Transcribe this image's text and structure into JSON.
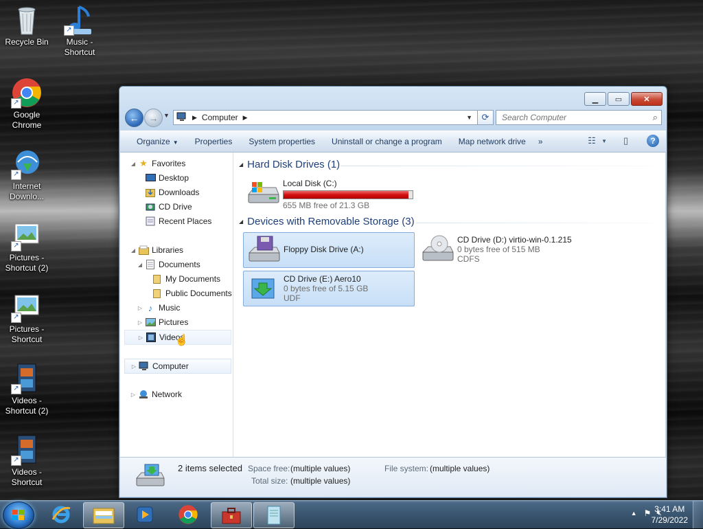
{
  "desktop": {
    "icons": [
      {
        "label": "Recycle Bin",
        "icon": "recycle-bin-icon"
      },
      {
        "label": "Music - Shortcut",
        "icon": "music-shortcut-icon"
      },
      {
        "label": "Google Chrome",
        "icon": "chrome-icon"
      },
      {
        "label": "Internet Downlo...",
        "icon": "internet-download-manager-icon"
      },
      {
        "label": "Pictures - Shortcut (2)",
        "icon": "pictures-shortcut-icon"
      },
      {
        "label": "Pictures - Shortcut",
        "icon": "pictures-shortcut-icon"
      },
      {
        "label": "Videos - Shortcut (2)",
        "icon": "videos-shortcut-icon"
      },
      {
        "label": "Videos - Shortcut",
        "icon": "videos-shortcut-icon"
      }
    ]
  },
  "window": {
    "address": {
      "root_icon": "computer-icon",
      "crumb": "Computer"
    },
    "search": {
      "placeholder": "Search Computer"
    },
    "toolbar": {
      "organize": "Organize",
      "properties": "Properties",
      "system_properties": "System properties",
      "uninstall": "Uninstall or change a program",
      "map_network_drive": "Map network drive",
      "more": "»"
    },
    "nav": {
      "favorites": "Favorites",
      "desktop": "Desktop",
      "downloads": "Downloads",
      "cd_drive": "CD Drive",
      "recent_places": "Recent Places",
      "libraries": "Libraries",
      "documents": "Documents",
      "my_documents": "My Documents",
      "public_documents": "Public Documents",
      "music": "Music",
      "pictures": "Pictures",
      "videos": "Videos",
      "computer": "Computer",
      "network": "Network"
    },
    "groups": {
      "hard_disk": "Hard Disk Drives (1)",
      "removable": "Devices with Removable Storage (3)"
    },
    "drives": {
      "c": {
        "name": "Local Disk (C:)",
        "free": "655 MB free of 21.3 GB",
        "used_fraction": 0.97
      },
      "a": {
        "name": "Floppy Disk Drive (A:)"
      },
      "d": {
        "name": "CD Drive (D:) virtio-win-0.1.215",
        "free": "0 bytes free of 515 MB",
        "fs": "CDFS"
      },
      "e": {
        "name": "CD Drive (E:) Aero10",
        "free": "0 bytes free of 5.15 GB",
        "fs": "UDF"
      }
    },
    "details": {
      "selection": "2 items selected",
      "space_free_label": "Space free:",
      "space_free_value": "(multiple values)",
      "total_size_label": "Total size:",
      "total_size_value": "(multiple values)",
      "file_system_label": "File system:",
      "file_system_value": "(multiple values)"
    }
  },
  "taskbar": {
    "items": [
      "windows-explorer",
      "media-player",
      "google-chrome",
      "toolbox",
      "notepad"
    ],
    "clock": {
      "time": "3:41 AM",
      "date": "7/29/2022"
    }
  },
  "colors": {
    "accent": "#1f3f7a",
    "disk_bar_critical": "#d41010",
    "selection": "#c7dff7"
  }
}
